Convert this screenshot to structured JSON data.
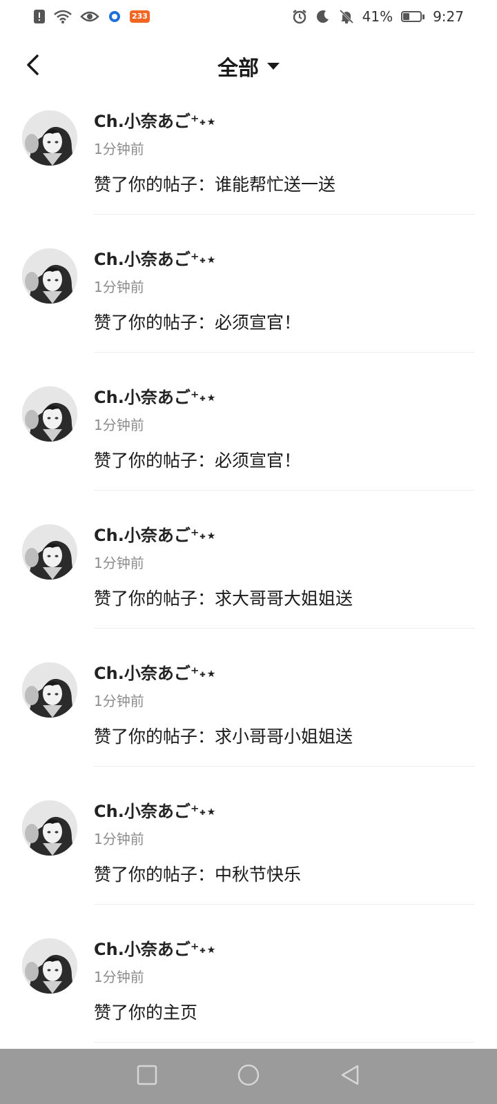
{
  "status_bar": {
    "battery": "41%",
    "battery_level": 0.41,
    "time": "9:27",
    "app_badge": "233"
  },
  "header": {
    "title": "全部"
  },
  "notifications": [
    {
      "username": "Ch.小奈あご⁺˖⋆",
      "time": "1分钟前",
      "content": "赞了你的帖子：谁能帮忙送一送"
    },
    {
      "username": "Ch.小奈あご⁺˖⋆",
      "time": "1分钟前",
      "content": "赞了你的帖子：必须宣官！"
    },
    {
      "username": "Ch.小奈あご⁺˖⋆",
      "time": "1分钟前",
      "content": "赞了你的帖子：必须宣官！"
    },
    {
      "username": "Ch.小奈あご⁺˖⋆",
      "time": "1分钟前",
      "content": "赞了你的帖子：求大哥哥大姐姐送"
    },
    {
      "username": "Ch.小奈あご⁺˖⋆",
      "time": "1分钟前",
      "content": "赞了你的帖子：求小哥哥小姐姐送"
    },
    {
      "username": "Ch.小奈あご⁺˖⋆",
      "time": "1分钟前",
      "content": "赞了你的帖子：中秋节快乐"
    },
    {
      "username": "Ch.小奈あご⁺˖⋆",
      "time": "1分钟前",
      "content": "赞了你的主页"
    }
  ],
  "icons": {
    "back": "back-arrow-icon",
    "dropdown": "caret-down-icon",
    "nav_recent": "square-icon",
    "nav_home": "circle-icon",
    "nav_back": "triangle-back-icon"
  },
  "colors": {
    "nav_bar": "#9b9b9b",
    "time_text": "#8c8c8c",
    "badge": "#f26522"
  }
}
